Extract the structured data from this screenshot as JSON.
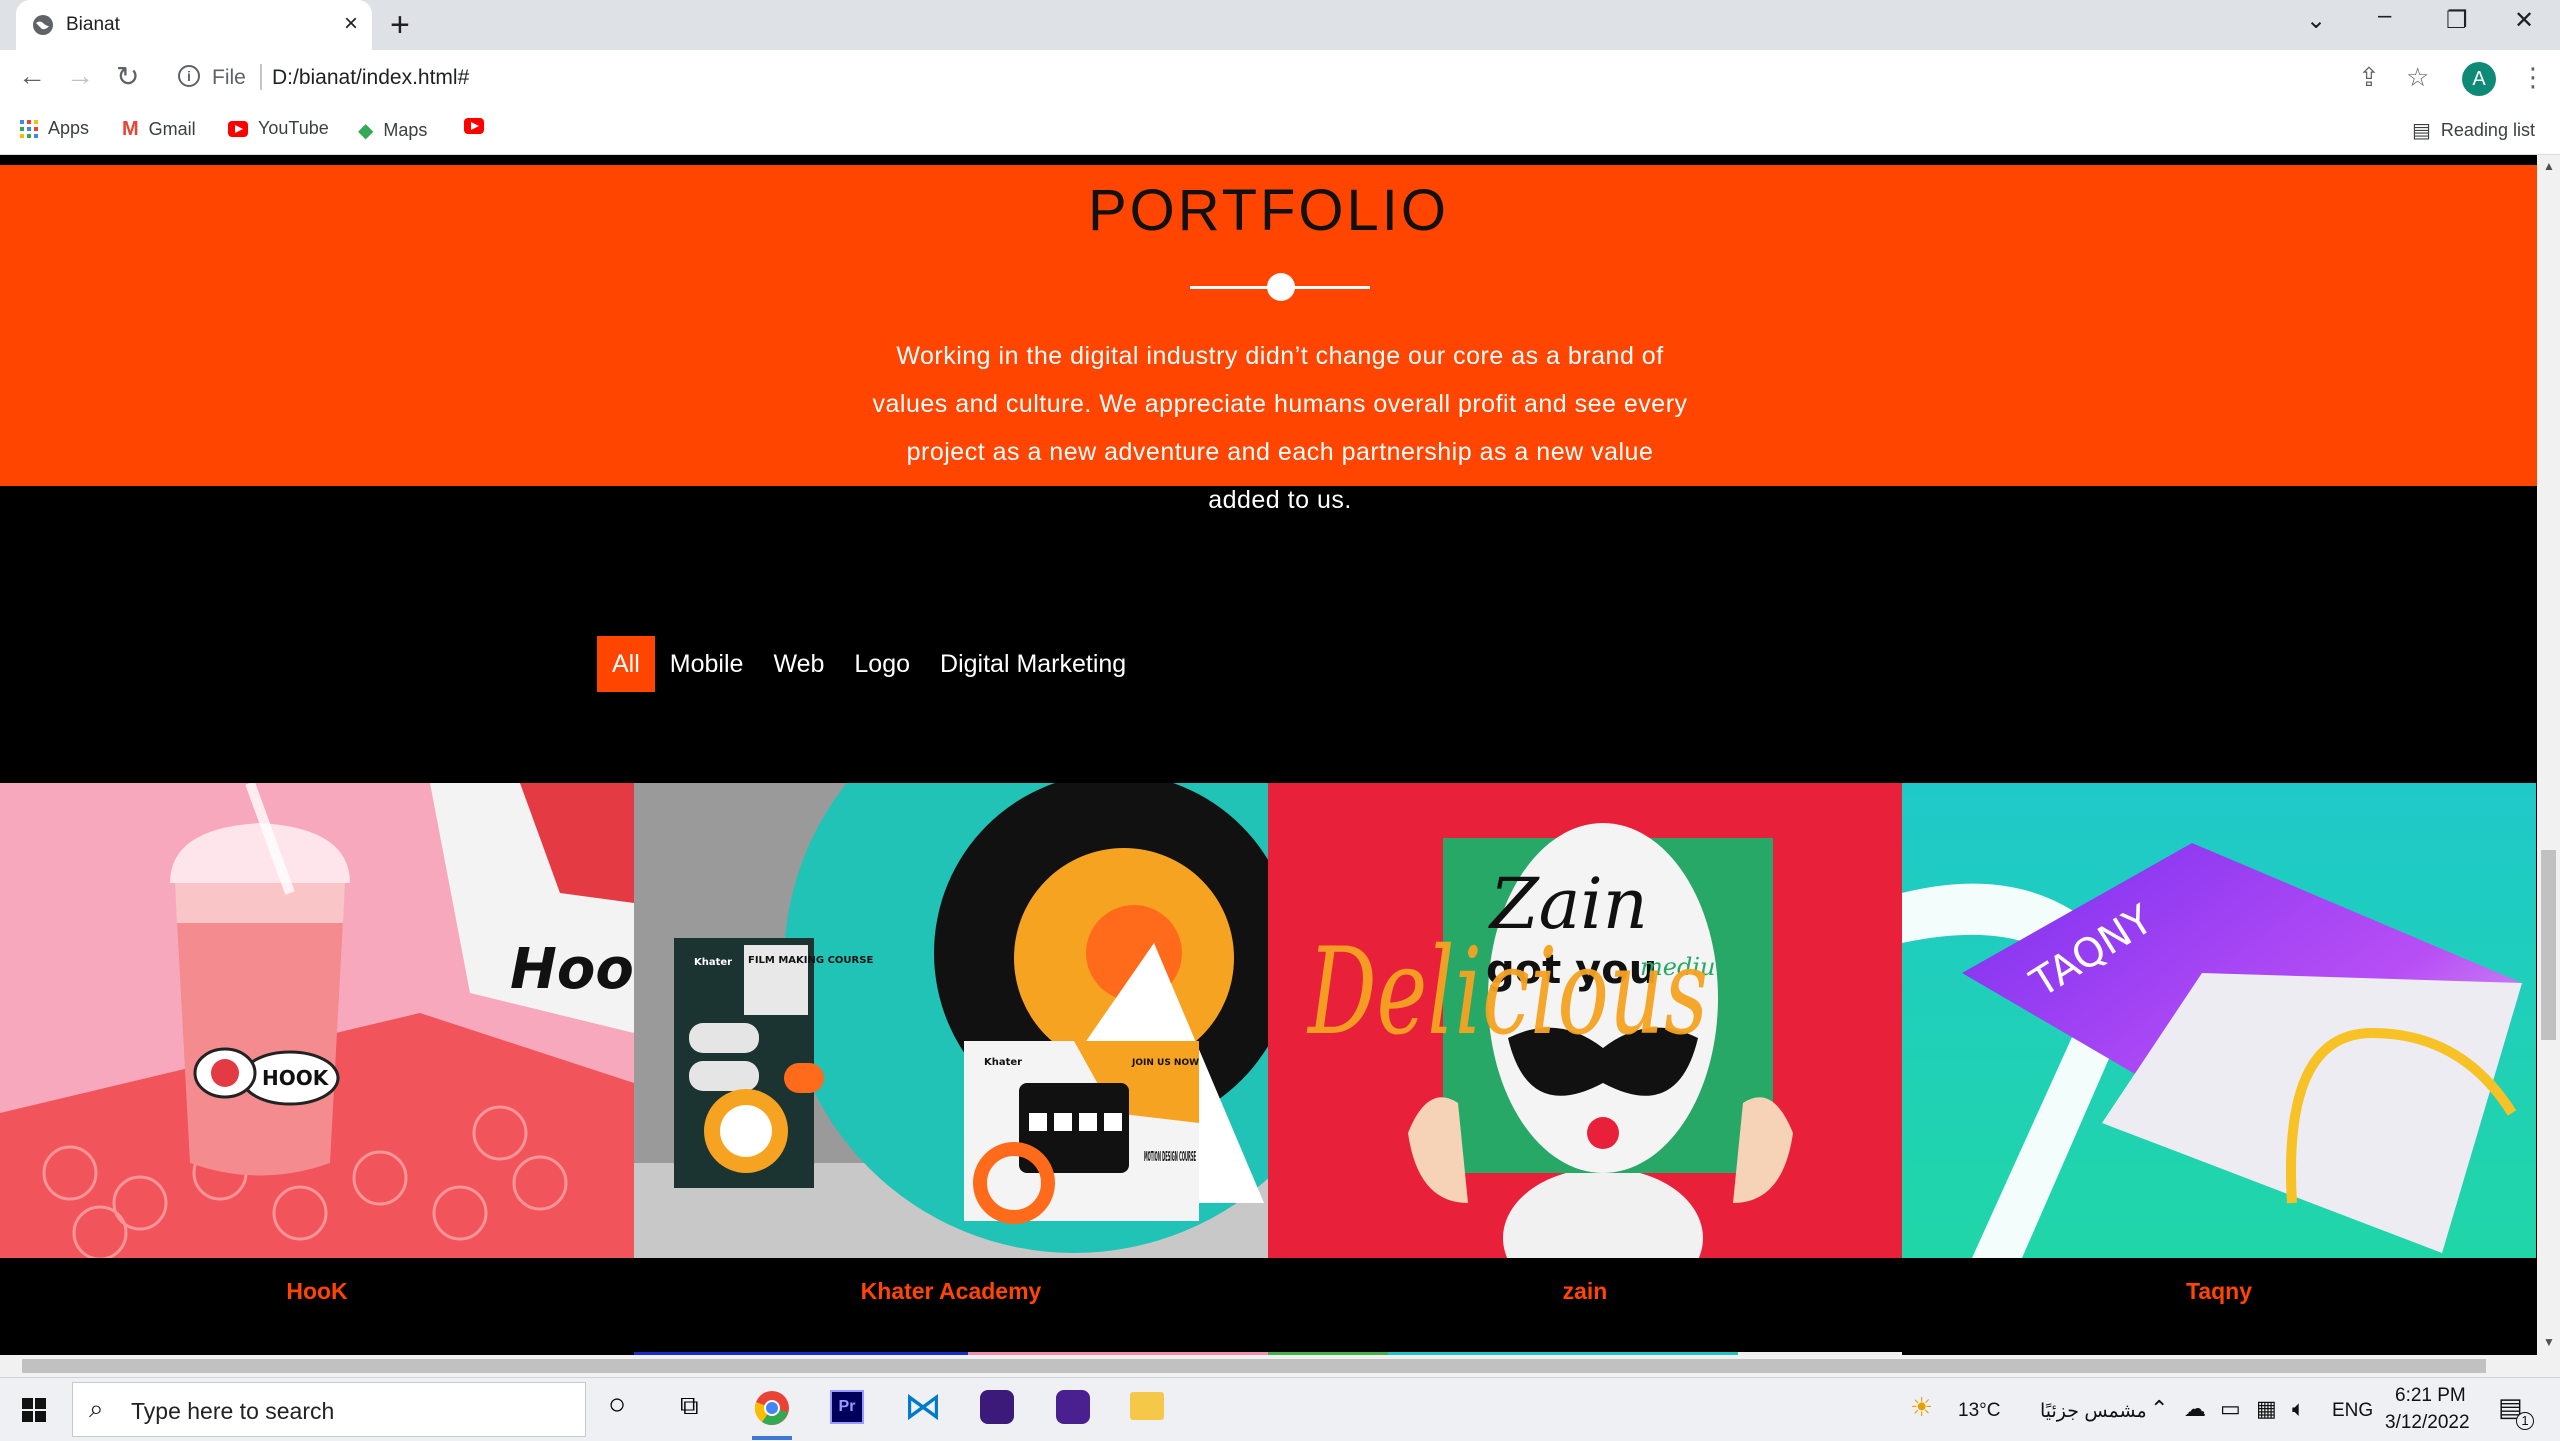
{
  "browser": {
    "tab_title": "Bianat",
    "url_scheme": "File",
    "url": "D:/bianat/index.html#",
    "avatar_letter": "A",
    "bookmarks": [
      "Apps",
      "Gmail",
      "YouTube",
      "Maps"
    ],
    "reading_list": "Reading list"
  },
  "portfolio": {
    "heading": "PORTFOLIO",
    "intro": "Working in the digital industry didn’t change our core as a brand of values and culture. We appreciate humans overall profit and see every project as a new adventure and each partnership as a new value added to us.",
    "accent": "#ff4500"
  },
  "filters": [
    "All",
    "Mobile",
    "Web",
    "Logo",
    "Digital Marketing"
  ],
  "projects": [
    {
      "caption": "HooK",
      "logo_text": "HooK",
      "sticker_text": "HOOK"
    },
    {
      "caption": "Khater Academy",
      "film_text": "FILM MAKING COURSE",
      "motion_text": "MOTION DESIGN COURSE",
      "brand_text": "Khater",
      "join_text": "JOIN US NOW"
    },
    {
      "caption": "zain",
      "box_line1": "Zain",
      "box_line2": "got you",
      "box_line3": "medium",
      "script_text": "Delicious"
    },
    {
      "caption": "Taqny",
      "bag_text": "TAQNY"
    }
  ],
  "taskbar": {
    "search_placeholder": "Type here to search",
    "temperature": "13°C",
    "weather": "مشمس جزئيًا",
    "language": "ENG",
    "time": "6:21 PM",
    "date": "3/12/2022",
    "notifications": "1"
  }
}
